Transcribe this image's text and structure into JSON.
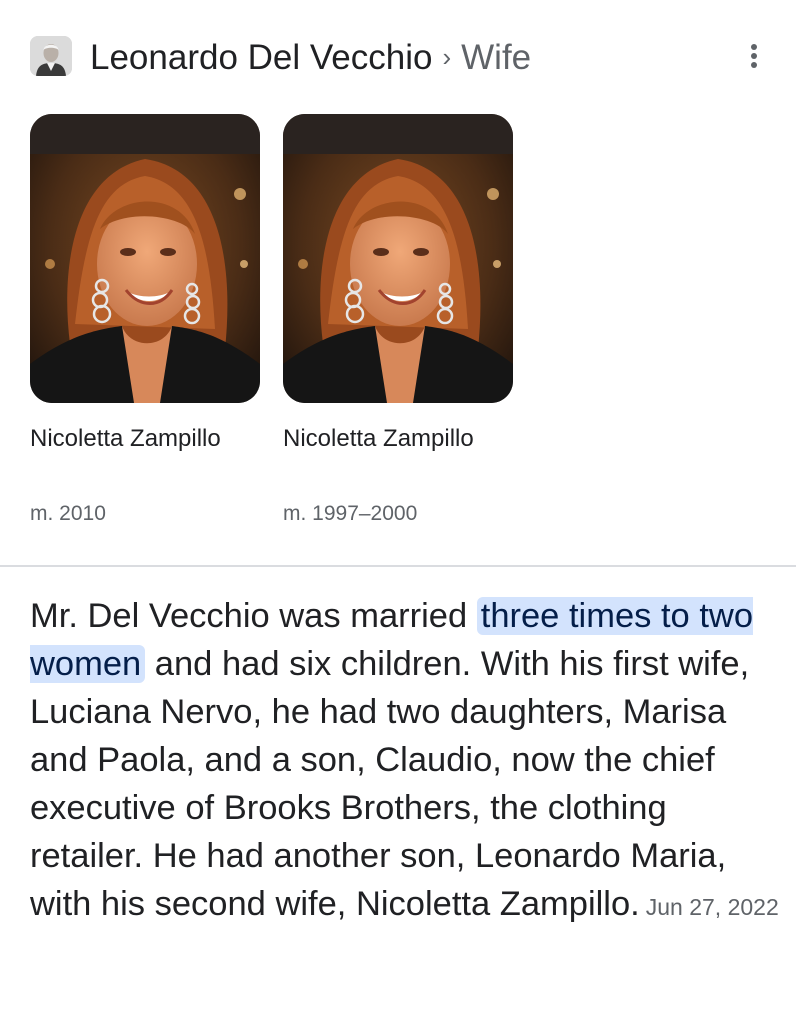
{
  "header": {
    "entity": "Leonardo Del Vecchio",
    "separator": "›",
    "attribute": "Wife",
    "more_icon": "more-vert-icon",
    "avatar_icon": "person-photo"
  },
  "spouses": [
    {
      "name": "Nicoletta Zampillo",
      "years": "m. 2010",
      "photo": "woman-portrait"
    },
    {
      "name": "Nicoletta Zampillo",
      "years": "m. 1997–2000",
      "photo": "woman-portrait"
    }
  ],
  "snippet": {
    "before": "Mr. Del Vecchio was married ",
    "highlight": "three times to two women",
    "after": " and had six children. With his first wife, Luciana Nervo, he had two daughters, Marisa and Paola, and a son, Claudio, now the chief executive of Brooks Brothers, the clothing retailer. He had another son, Leonardo Maria, with his second wife, Nicoletta Zampillo.",
    "date": "Jun 27, 2022"
  },
  "colors": {
    "highlight_bg": "#d3e3fd",
    "highlight_text": "#041e49",
    "secondary_text": "#5f6368",
    "primary_text": "#202124"
  }
}
